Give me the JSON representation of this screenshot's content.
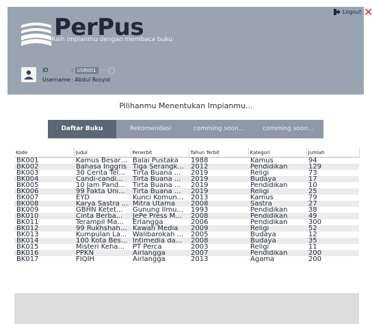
{
  "app": {
    "title": "PerPus",
    "subtitle": "Raih impianmu dengan membaca buku",
    "logout_label": "Logout",
    "close_glyph": "✕"
  },
  "user": {
    "id_label": "ID",
    "id_sep": ":",
    "id_value": "USR001",
    "id_dash": "---",
    "username_label": "Username",
    "username_value": ": Abdul Rosyid"
  },
  "tagline": "Pilihanmu Menentukan Impianmu...",
  "tabs": [
    {
      "label": "Daftar Buku",
      "active": true
    },
    {
      "label": "Rekomendasi",
      "active": false
    },
    {
      "label": "comming soon...",
      "active": false
    },
    {
      "label": "comming soon...",
      "active": false
    }
  ],
  "table": {
    "columns": [
      "Kode",
      "Judul",
      "Penerbit",
      "Tahun Terbit",
      "Kategori",
      "Jumlah"
    ],
    "rows": [
      [
        "BK001",
        "Kamus Besar ...",
        "Balai Pustaka",
        "1988",
        "Kamus",
        "94"
      ],
      [
        "BK002",
        "Bahasa Inggris",
        "Tiga Serangk...",
        "2012",
        "Pendidikan",
        "129"
      ],
      [
        "BK003",
        "30 Cerita Tel...",
        "Tirta Buana ...",
        "2019",
        "Religi",
        "73"
      ],
      [
        "BK004",
        "Candi-candi...",
        "Tirta Buana ...",
        "2019",
        "Budaya",
        "17"
      ],
      [
        "BK005",
        "10 Jam Pand...",
        "Tirta Buana ...",
        "2019",
        "Pendidikan",
        "10"
      ],
      [
        "BK006",
        "99 Fakta Uni...",
        "Tirta Buana ...",
        "2019",
        "Religi",
        "25"
      ],
      [
        "BK007",
        "EYD",
        "Kunci Komun...",
        "2013",
        "Kamus",
        "79"
      ],
      [
        "BK008",
        "Karya Sastra ...",
        "Mitra Utama",
        "2008",
        "Sastra",
        "27"
      ],
      [
        "BK009",
        "GBHN Ketet...",
        "Gunung Ilmu...",
        "1993",
        "Pendidikan",
        "38"
      ],
      [
        "BK010",
        "Cinta Berba...",
        "JePe Press M...",
        "2008",
        "Pendidikan",
        "49"
      ],
      [
        "BK011",
        "Terampil Ma...",
        "Erlangga",
        "2006",
        "Pendidikan",
        "300"
      ],
      [
        "BK012",
        "99 Rukhshah ...",
        "Kawah Media",
        "2009",
        "Religi",
        "52"
      ],
      [
        "BK013",
        "Kumpulan La...",
        "Walibarokah ...",
        "2005",
        "Budaya",
        "12"
      ],
      [
        "BK014",
        "100 Kota Bes...",
        "Intimedia da...",
        "2008",
        "Budaya",
        "35"
      ],
      [
        "BK015",
        "Misteri Keha...",
        "PT Perca",
        "2003",
        "Religi",
        "11"
      ],
      [
        "BK016",
        "PPKN",
        "Airlangga",
        "2007",
        "Pendidikan",
        "200"
      ],
      [
        "BK017",
        "FIQIH",
        "Airlangga",
        "2013",
        "Agama",
        "200"
      ]
    ]
  },
  "colors": {
    "header_bg": "#9aa3b1",
    "tab_active": "#5d6675",
    "tab_inactive": "#8e98a6",
    "close_red": "#e0202a"
  },
  "icons": [
    "books-icon",
    "logout-icon",
    "close-icon",
    "user-icon",
    "eye-icon"
  ]
}
